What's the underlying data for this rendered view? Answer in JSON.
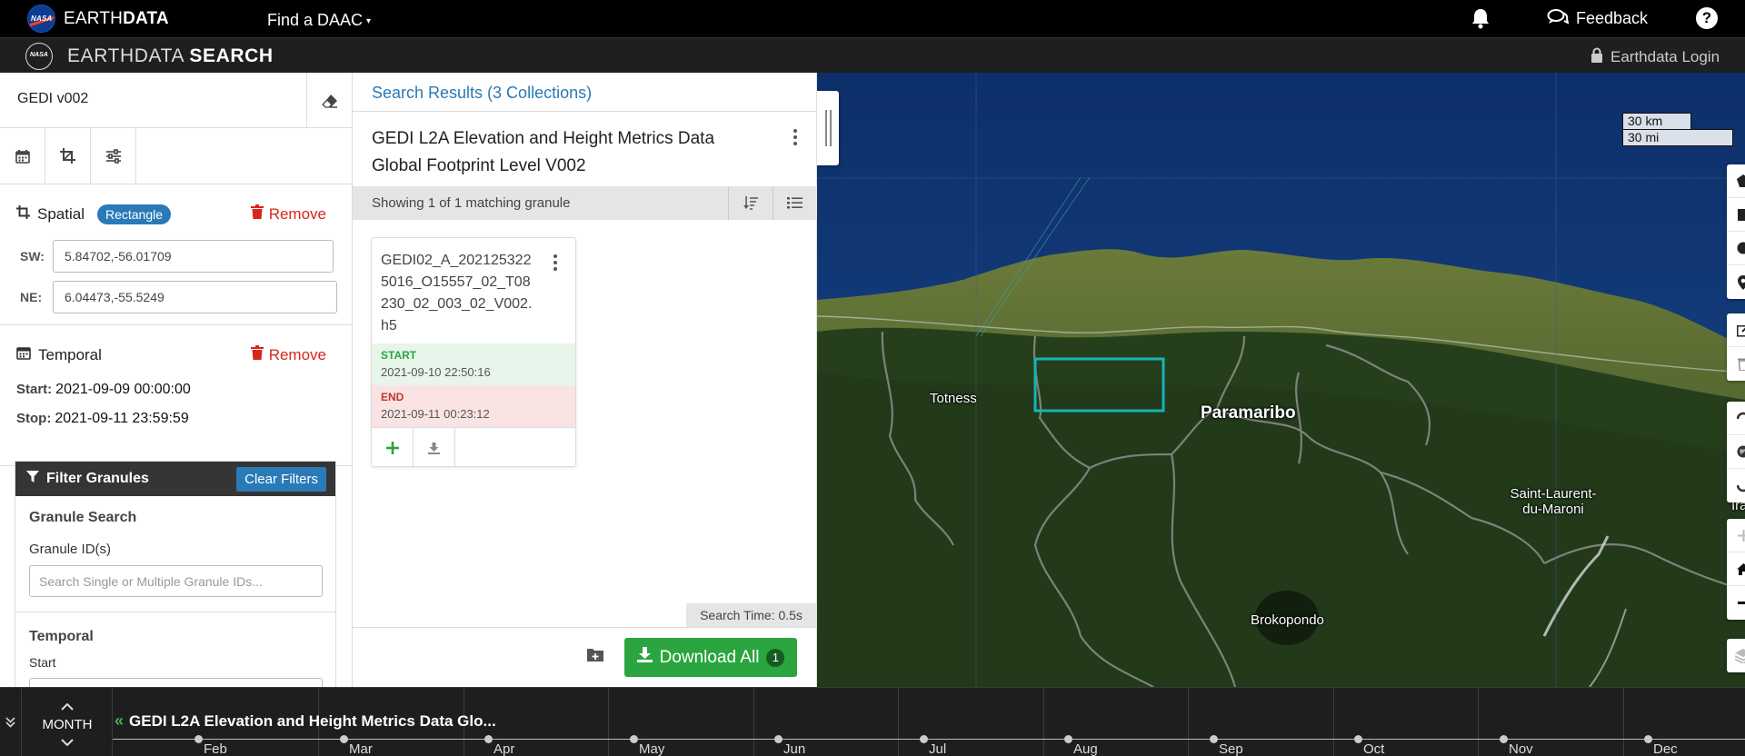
{
  "header": {
    "nasa_logo_text": "NASA",
    "brand_light": "EARTH",
    "brand_bold": "DATA",
    "find_daac": "Find a DAAC",
    "feedback": "Feedback",
    "help": "?"
  },
  "subheader": {
    "title_light": "EARTHDATA ",
    "title_bold": "SEARCH",
    "login": "Earthdata Login"
  },
  "sidebar": {
    "search_value": "GEDI v002",
    "spatial": {
      "title": "Spatial",
      "badge": "Rectangle",
      "remove": "Remove",
      "sw_label": "SW:",
      "sw_value": "5.84702,-56.01709",
      "ne_label": "NE:",
      "ne_value": "6.04473,-55.5249"
    },
    "temporal": {
      "title": "Temporal",
      "remove": "Remove",
      "start_label": "Start:",
      "start_value": "2021-09-09 00:00:00",
      "stop_label": "Stop:",
      "stop_value": "2021-09-11 23:59:59"
    },
    "filter_granules": {
      "title": "Filter Granules",
      "clear": "Clear Filters",
      "granule_search_title": "Granule Search",
      "granule_ids_label": "Granule ID(s)",
      "granule_ids_placeholder": "Search Single or Multiple Granule IDs...",
      "temporal_title": "Temporal",
      "start_label": "Start"
    }
  },
  "results": {
    "title": "Search Results (3 Collections)",
    "collection_title": "GEDI L2A Elevation and Height Metrics Data Global Footprint Level V002",
    "showing": "Showing 1 of 1 matching granule",
    "granule": {
      "title": "GEDI02_A_2021253225016_O15557_02_T08230_02_003_02_V002.h5",
      "start_label": "START",
      "start_value": "2021-09-10 22:50:16",
      "end_label": "END",
      "end_value": "2021-09-11 00:23:12"
    },
    "search_time": "Search Time: 0.5s",
    "download_all": "Download All",
    "download_count": "1"
  },
  "map": {
    "labels": {
      "totness": "Totness",
      "paramaribo": "Paramaribo",
      "saint_laurent": "Saint-Laurent-\ndu-Maroni",
      "brokopondo": "Brokopondo",
      "ira": "Ira"
    },
    "scale_km": "30 km",
    "scale_mi": "30 mi"
  },
  "timeline": {
    "period": "MONTH",
    "collection": "GEDI L2A Elevation and Height Metrics Data Glo...",
    "months": [
      "Feb",
      "Mar",
      "Apr",
      "May",
      "Jun",
      "Jul",
      "Aug",
      "Sep",
      "Oct",
      "Nov",
      "Dec"
    ]
  },
  "colors": {
    "accent_blue": "#2a7ab8",
    "remove_red": "#d9261c",
    "download_green": "#2aa540",
    "bounding_box": "#17b3b8"
  }
}
